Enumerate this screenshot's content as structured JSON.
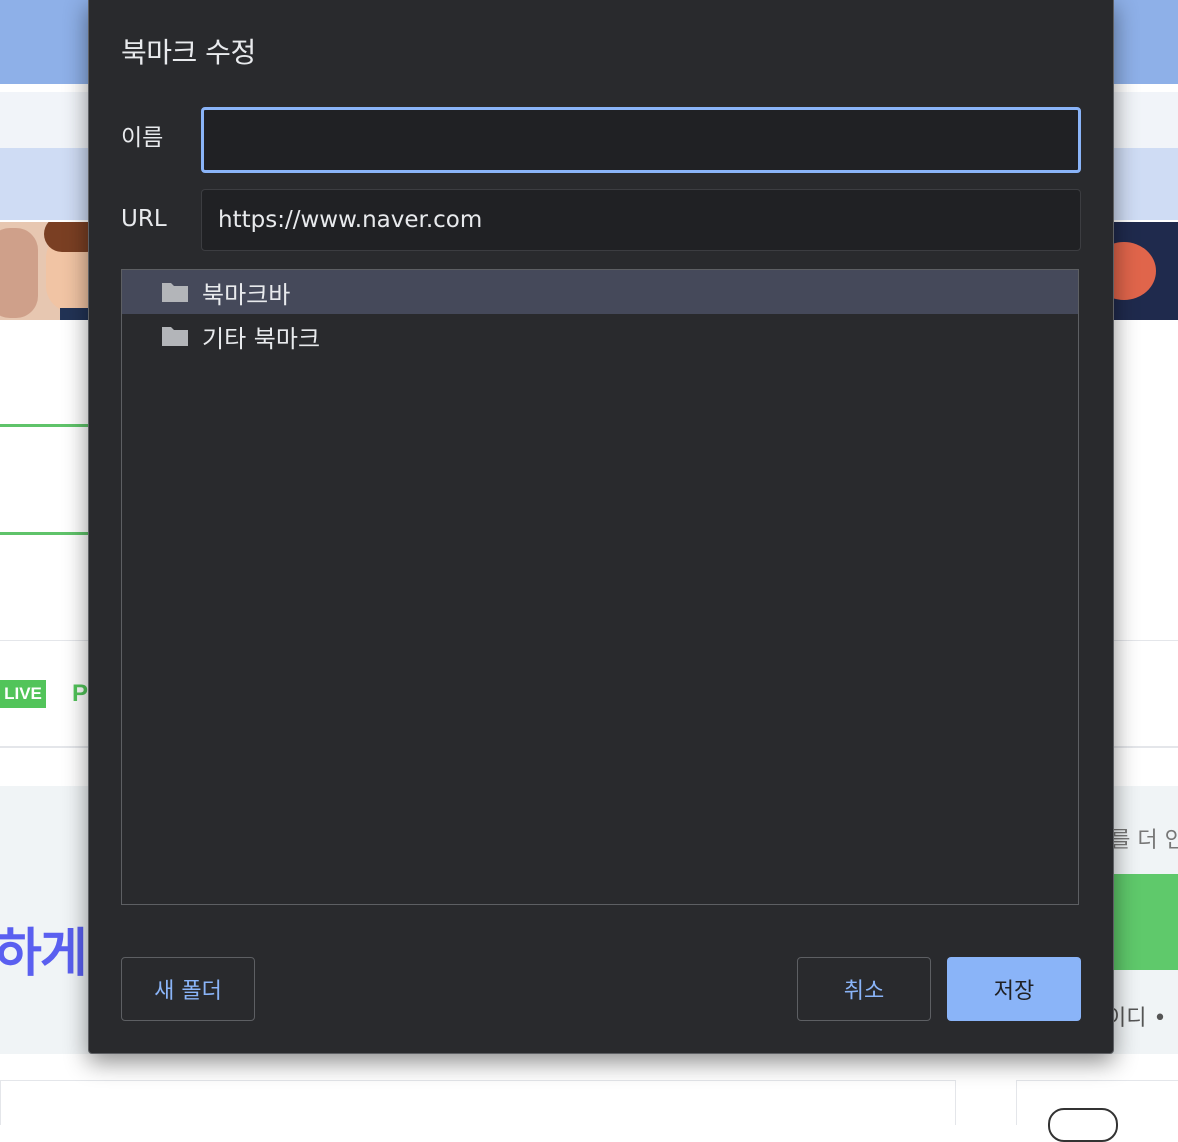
{
  "dialog": {
    "title": "북마크 수정",
    "name_label": "이름",
    "name_value": "",
    "url_label": "URL",
    "url_value": "https://www.naver.com",
    "folders": [
      {
        "label": "북마크바",
        "selected": true
      },
      {
        "label": "기타 북마크",
        "selected": false
      }
    ],
    "buttons": {
      "new_folder": "새 폴더",
      "cancel": "취소",
      "save": "저장"
    }
  },
  "background_page": {
    "live_badge": "LIVE",
    "live_next": "P",
    "promo_text": "하게!",
    "right_text": "l를 더 인",
    "right_text2": "이디 •"
  },
  "colors": {
    "dialog_bg": "#292a2d",
    "input_bg": "#202124",
    "accent": "#8ab4f8",
    "selected_row": "#45495a"
  },
  "icons": {
    "folder": "folder-icon"
  }
}
